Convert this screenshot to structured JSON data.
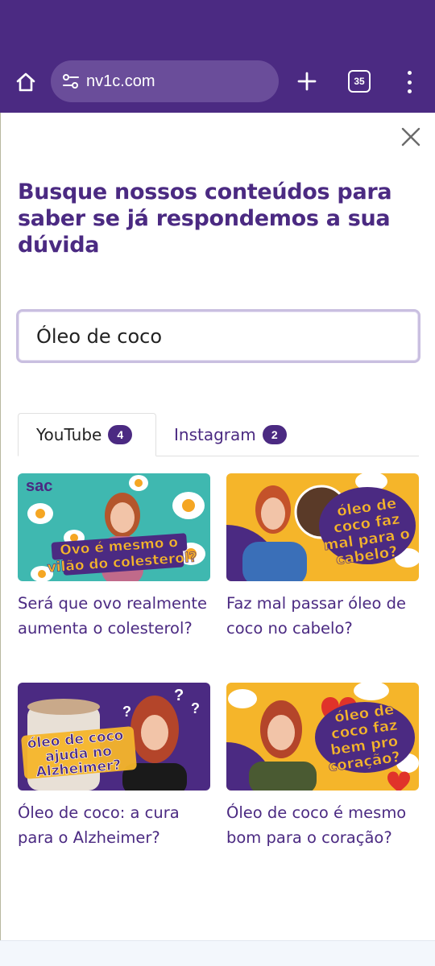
{
  "browser": {
    "url": "nv1c.com",
    "tab_count": "35",
    "colors": {
      "bar": "#4b2a82",
      "url_box": "#6a4d9a"
    }
  },
  "overlay": {
    "headline": "Busque nossos conteúdos para saber se já respondemos a sua dúvida",
    "search_value": "Óleo de coco"
  },
  "tabs": [
    {
      "label": "YouTube",
      "count": "4"
    },
    {
      "label": "Instagram",
      "count": "2"
    }
  ],
  "videos": [
    {
      "title": "Será que ovo realmente aumenta o colesterol?",
      "thumb_caption": "Ovo é mesmo o vilão do colesterol?",
      "thumb_logo": "sac"
    },
    {
      "title": "Faz mal passar óleo de coco no cabelo?",
      "thumb_caption": "óleo de coco faz mal para o cabelo?"
    },
    {
      "title": "Óleo de coco: a cura para o Alzheimer?",
      "thumb_caption": "óleo de coco ajuda no Alzheimer?"
    },
    {
      "title": "Óleo de coco é mesmo bom para o coração?",
      "thumb_caption": "óleo de coco faz bem pro coração?"
    }
  ]
}
